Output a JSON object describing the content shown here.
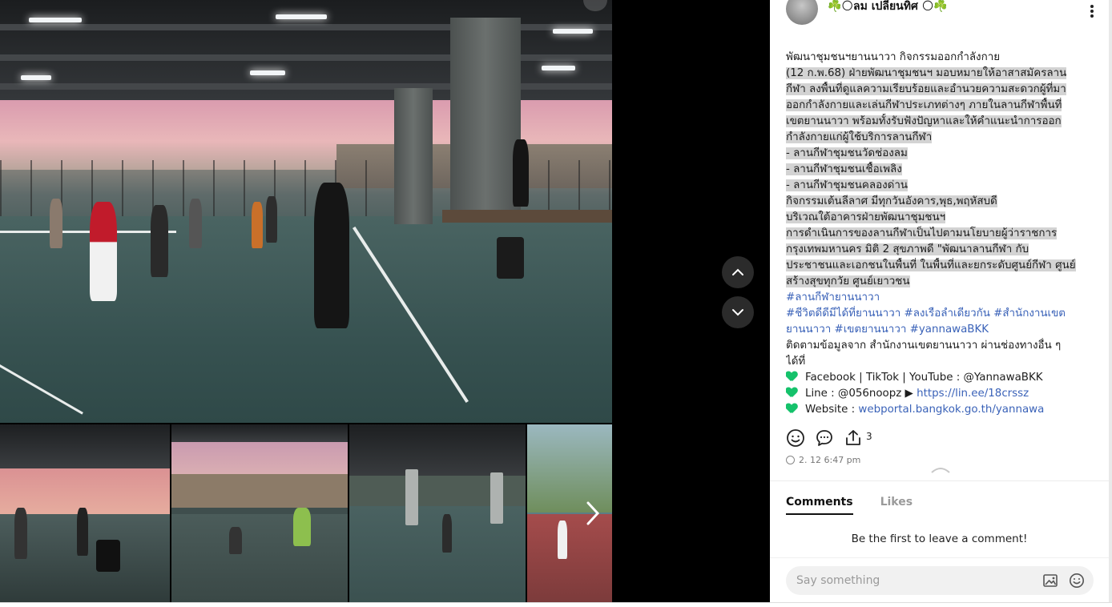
{
  "post": {
    "author": "☘️🌕ลม เปลี่ยนทิศ 🌕☘️",
    "caption": {
      "title": "พัฒนาชุมชนฯยานนาวา กิจกรรมออกกำลังกาย",
      "lines": [
        " (12 ก.พ.68)  ฝ่ายพัฒนาชุมชนฯ มอบหมายให้อาสาสมัครลาน",
        "กีฬา ลงพื้นที่ดูแลความเรียบร้อยและอำนวยความสะดวกผู้ที่มา",
        "ออกกำลังกายและเล่นกีฬาประเภทต่างๆ ภายในลานกีฬาพื้นที่",
        "เขตยานนาวา พร้อมทั้งรับฟังปัญหาและให้คำแนะนำการออก",
        "กำลังกายแก่ผู้ใช้บริการลานกีฬา",
        "- ลานกีฬาชุมชนวัดช่องลม",
        "- ลานกีฬาชุมชนเชื้อเพลิง",
        "- ลานกีฬาชุมชนคลองด่าน",
        "กิจกรรมเต้นลีลาศ มีทุกวันอังคาร,พุธ,พฤหัสบดี",
        "บริเวณใต้อาคารฝ่ายพัฒนาชุมชนฯ",
        "   การดำเนินการของลานกีฬาเป็นไปตามนโยบายผู้ว่าราชการ",
        "กรุงเทพมหานคร  มิติ 2 สุขภาพดี  \"พัฒนาลานกีฬา กับ",
        "ประชาชนและเอกชนในพื้นที่ ในพื้นที่และยกระดับศูนย์กีฬา ศูนย์",
        "สร้างสุขทุกวัย ศูนย์เยาวชน"
      ],
      "hashtag_line1": "#ลานกีฬายานนาวา",
      "hashtag_line2": "#ชีวิตดีดีมีได้ที่ยานนาวา #ลงเรือลำเดียวกัน #สำนักงานเขต",
      "hashtag_line3": "ยานนาวา #เขตยานนาวา #yannawaBKK",
      "follow_line1": "ติดตามข้อมูลจาก สำนักงานเขตยานนาวา ผ่านช่องทางอื่น ๆ",
      "follow_line2": "ได้ที่",
      "contact1": "Facebook | TikTok | YouTube : @YannawaBKK",
      "contact2_prefix": "Line : @056noopz ▶",
      "contact2_link": "https://lin.ee/18crssz",
      "contact3_prefix": "Website :",
      "contact3_link": "webportal.bangkok.go.th/yannawa"
    },
    "share_count": "3",
    "timestamp": "2. 12 6:47 pm"
  },
  "comments": {
    "tab_comments": "Comments",
    "tab_likes": "Likes",
    "empty_message": "Be the first to leave a comment!",
    "input_placeholder": "Say something"
  },
  "icons": {
    "prev": "chevron-up-icon",
    "next": "chevron-down-icon",
    "gallery_next": "chevron-right-icon"
  },
  "colors": {
    "hashtag": "#3a62b8",
    "heart": "#15c26b",
    "highlight": "#d3d3d3"
  }
}
